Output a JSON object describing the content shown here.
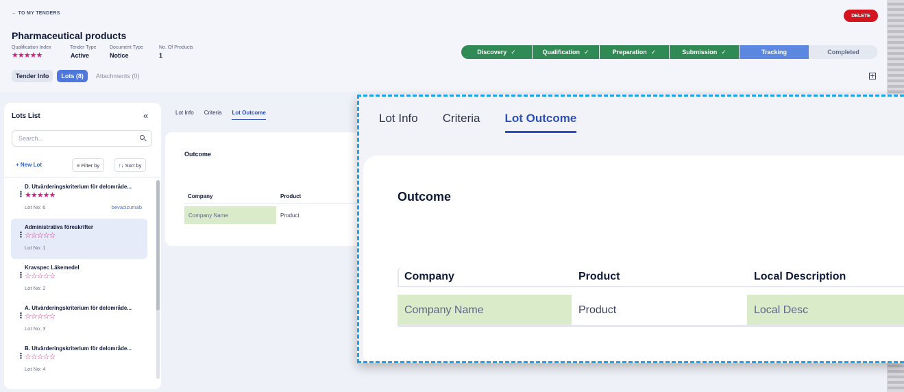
{
  "header": {
    "back_label": "← TO MY TENDERS",
    "delete_label": "DELETE",
    "title": "Pharmaceutical products",
    "meta": [
      {
        "label": "Qualification Index",
        "value": ""
      },
      {
        "label": "Tender Type",
        "value": "Active"
      },
      {
        "label": "Document Type",
        "value": "Notice"
      },
      {
        "label": "No. Of Products",
        "value": "1"
      }
    ],
    "qualification_stars": "★★★★★",
    "qualification_rating": 5,
    "pipeline": [
      {
        "label": "Discovery",
        "status": "done"
      },
      {
        "label": "Qualification",
        "status": "done"
      },
      {
        "label": "Preparation",
        "status": "done"
      },
      {
        "label": "Submission",
        "status": "done"
      },
      {
        "label": "Tracking",
        "status": "current"
      },
      {
        "label": "Completed",
        "status": "future"
      }
    ],
    "check_glyph": "✓",
    "tabs": [
      {
        "label": "Tender Info"
      },
      {
        "label": "Lots (8)"
      },
      {
        "label": "Attachments (0)"
      }
    ]
  },
  "lots": {
    "title": "Lots List",
    "collapse_glyph": "«",
    "search_placeholder": "Search...",
    "new_lot_label": "+ New Lot",
    "filter_label": "≡ Filter by",
    "sort_label": "↑↓ Sort by",
    "items": [
      {
        "name": "D. Utvärderingskriterium för delområde...",
        "stars": "★★★★★",
        "rating": 5,
        "lot_no": "Lot No: 6",
        "tag": "bevacizumab"
      },
      {
        "name": "Administrativa föreskrifter",
        "stars": "☆☆☆☆☆",
        "rating": 0,
        "lot_no": "Lot No: 1",
        "tag": ""
      },
      {
        "name": "Kravspec Läkemedel",
        "stars": "☆☆☆☆☆",
        "rating": 0,
        "lot_no": "Lot No: 2",
        "tag": ""
      },
      {
        "name": "A. Utvärderingskriterium för delområde...",
        "stars": "☆☆☆☆☆",
        "rating": 0,
        "lot_no": "Lot No: 3",
        "tag": ""
      },
      {
        "name": "B. Utvärderingskriterium för delområde...",
        "stars": "☆☆☆☆☆",
        "rating": 0,
        "lot_no": "Lot No: 4",
        "tag": ""
      }
    ]
  },
  "content": {
    "tabs": [
      {
        "label": "Lot Info"
      },
      {
        "label": "Criteria"
      },
      {
        "label": "Lot Outcome"
      }
    ],
    "outcome_title": "Outcome",
    "columns": [
      "Company",
      "Product",
      "Local Description"
    ],
    "row": [
      "Company Name",
      "Product",
      "Local Desc"
    ]
  },
  "colors": {
    "accent": "#4f78dc",
    "done_stage": "#2f8a53",
    "delete": "#d4141e",
    "stars": "#d0207e",
    "highlight_cell": "#d9ebc9",
    "zoom_border": "#1da1e8"
  }
}
